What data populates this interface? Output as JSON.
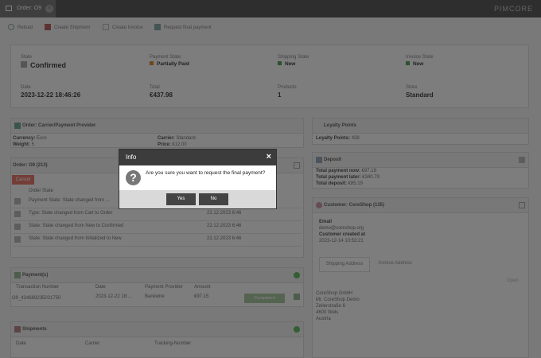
{
  "tab": {
    "title": "Order: O9",
    "close": "×"
  },
  "brand": "PIMCORE",
  "toolbar": {
    "reload": "Reload",
    "create_shipment": "Create Shipment",
    "create_invoice": "Create Invoice",
    "request_final_payment": "Request final payment"
  },
  "summary": {
    "state_label": "State",
    "state_value": "Confirmed",
    "payment_state_label": "Payment State",
    "payment_state_value": "Partially Paid",
    "shipping_state_label": "Shipping State",
    "shipping_state_value": "New",
    "invoice_state_label": "Invoice State",
    "invoice_state_value": "New",
    "date_label": "Date",
    "date_value": "2023-12-22 18:46:26",
    "total_label": "Total",
    "total_value": "€437.98",
    "products_label": "Products",
    "products_value": "1",
    "store_label": "Store",
    "store_value": "Standard",
    "colors": {
      "payment": "#e08a3a",
      "shipping": "#5aa05a",
      "invoice": "#5aa05a"
    }
  },
  "carrier": {
    "title": "Order: Carrier/Payment Provider",
    "currency_label": "Currency:",
    "currency_value": "Euro",
    "weight_label": "Weight:",
    "weight_value": "5",
    "carrier_label": "Carrier:",
    "carrier_value": "Standard",
    "price_label": "Price:",
    "price_value": "€12.00"
  },
  "history": {
    "title": "Order: O9 (213)",
    "cancel": "Cancel",
    "col_state": "Order State",
    "rows": [
      {
        "text": "Payment State: State changed from ...",
        "date": ""
      },
      {
        "text": "Type: State changed from Cart to Order",
        "date": "22.12.2023 6:46"
      },
      {
        "text": "State: State changed from New to Confirmed",
        "date": "22.12.2023 6:46"
      },
      {
        "text": "State: State changed from Initialized to New",
        "date": "22.12.2023 6:46"
      }
    ]
  },
  "payments": {
    "title": "Payment(s)",
    "columns": [
      "Transaction Number",
      "Date",
      "Payment Provider",
      "Amount"
    ],
    "row": {
      "number": "O9_434669235021750",
      "date": "2023-12-22 18:...",
      "provider": "Bankwire",
      "amount": "€97.15",
      "status": "Completed"
    }
  },
  "shipments": {
    "title": "Shipments",
    "columns": [
      "Date",
      "Carrier",
      "Tracking-Number"
    ]
  },
  "loyalty": {
    "title": "Loyalty Points",
    "label": "Loyalty Points:",
    "value": "438"
  },
  "deposit": {
    "title": "Deposit",
    "now_label": "Total payment now:",
    "now_value": "€97.19",
    "later_label": "Total payment later:",
    "later_value": "€340.79",
    "deposit_label": "Total deposit:",
    "deposit_value": "€85.19"
  },
  "customer": {
    "title": "Customer: CoreShop (135)",
    "email_label": "Email",
    "email_value": "demo@coreshop.org",
    "created_label": "Customer created at",
    "created_value": "2023-12-14 10:53:21",
    "tab_shipping": "Shipping Address",
    "tab_invoice": "Invoice Address",
    "open": "Open",
    "address": [
      "CoreShop GmbH",
      "Mr. CoreShop Demo",
      "Zellerstraße 6",
      "4600 Wels",
      "Austria"
    ]
  },
  "dialog": {
    "title": "Info",
    "close": "×",
    "icon": "?",
    "message": "Are you sure you want to request the final payment?",
    "yes": "Yes",
    "no": "No"
  }
}
